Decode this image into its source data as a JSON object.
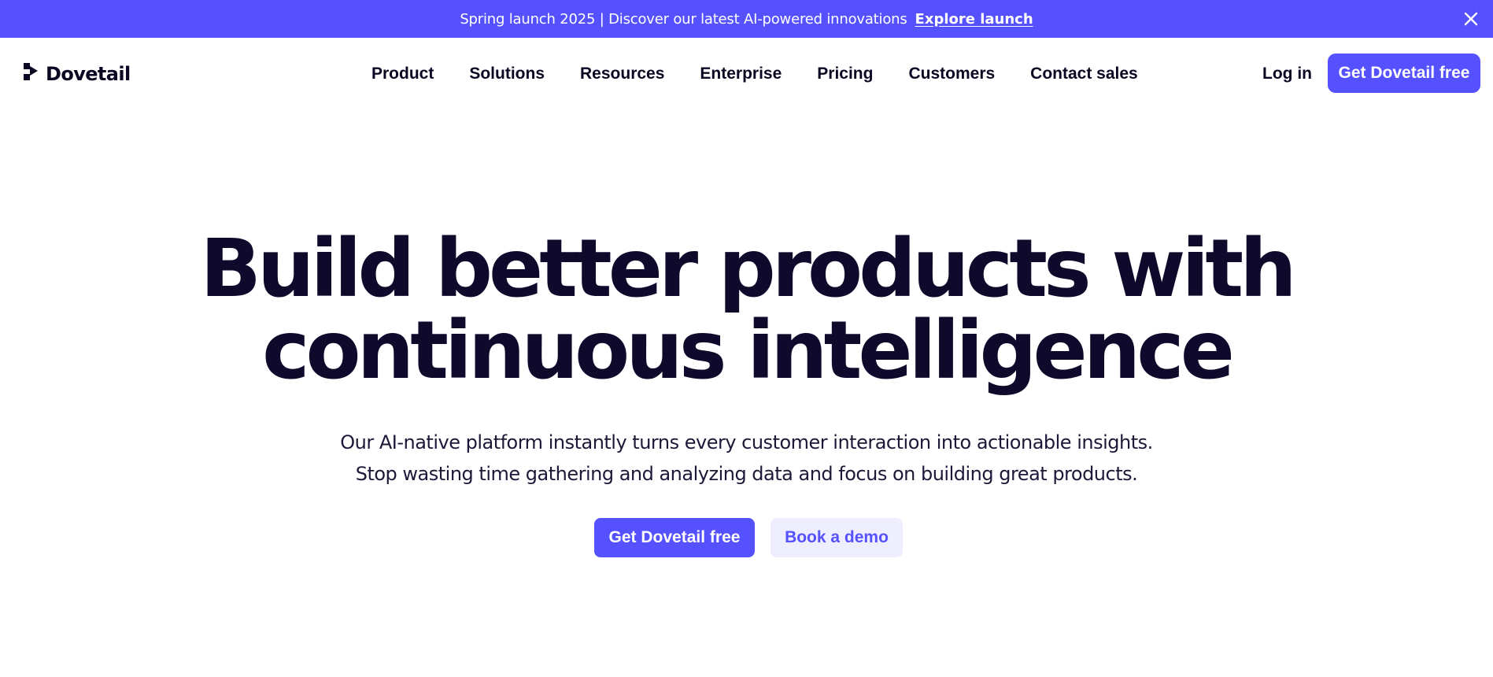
{
  "banner": {
    "text": "Spring launch 2025 | Discover our latest AI-powered innovations",
    "link_label": "Explore launch",
    "close_icon": "close-icon",
    "background": "#5651ff"
  },
  "header": {
    "logo_text": "Dovetail",
    "logo_icon": "dovetail-logo-icon",
    "nav": [
      {
        "label": "Product"
      },
      {
        "label": "Solutions"
      },
      {
        "label": "Resources"
      },
      {
        "label": "Enterprise"
      },
      {
        "label": "Pricing"
      },
      {
        "label": "Customers"
      },
      {
        "label": "Contact sales"
      }
    ],
    "login_label": "Log in",
    "cta_label": "Get Dovetail free"
  },
  "hero": {
    "title_line1": "Build better products with",
    "title_line2": "continuous intelligence",
    "subtitle_line1": "Our AI-native platform instantly turns every customer interaction into actionable insights.",
    "subtitle_line2": "Stop wasting time gathering and analyzing data and focus on building great products.",
    "primary_cta": "Get Dovetail free",
    "secondary_cta": "Book a demo"
  },
  "colors": {
    "accent": "#5651ff",
    "accent_light": "#eeeeff",
    "text_dark": "#0f0a2c"
  }
}
